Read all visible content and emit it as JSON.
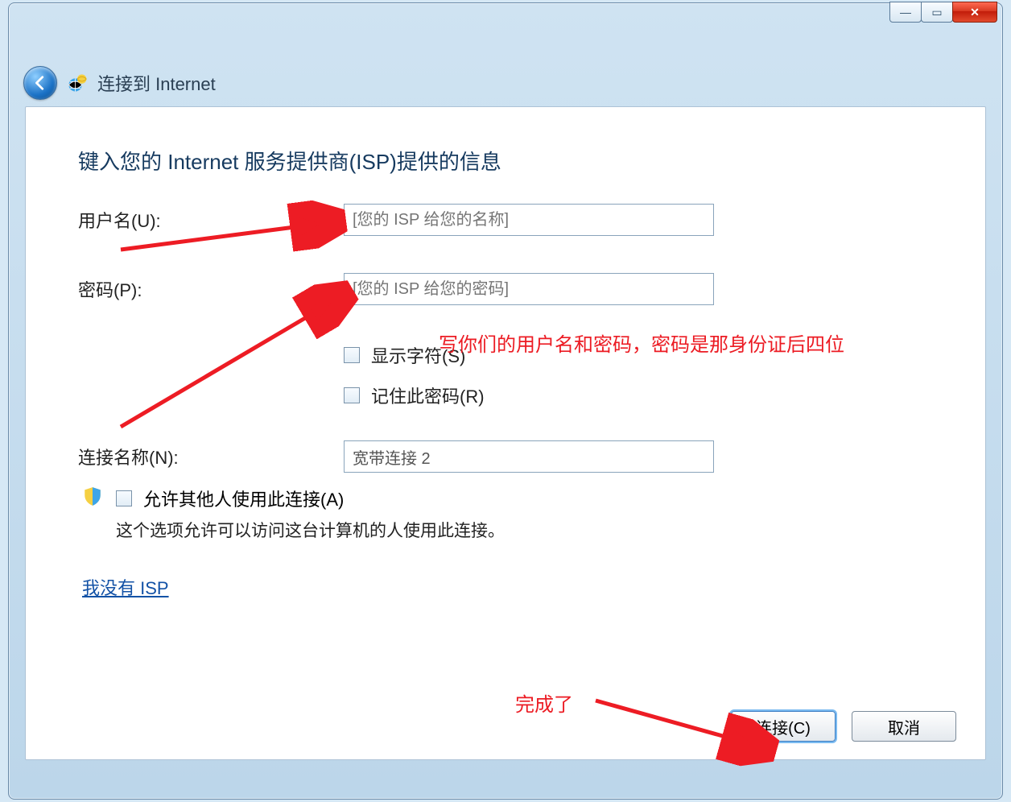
{
  "window": {
    "title": "连接到 Internet"
  },
  "heading": "键入您的 Internet 服务提供商(ISP)提供的信息",
  "form": {
    "username_label": "用户名(U):",
    "username_placeholder": "[您的 ISP 给您的名称]",
    "password_label": "密码(P):",
    "password_placeholder": "[您的 ISP 给您的密码]",
    "show_chars_label": "显示字符(S)",
    "remember_pwd_label": "记住此密码(R)",
    "conn_name_label": "连接名称(N):",
    "conn_name_value": "宽带连接 2"
  },
  "allow": {
    "label": "允许其他人使用此连接(A)",
    "sub": "这个选项允许可以访问这台计算机的人使用此连接。"
  },
  "link": "我没有 ISP",
  "buttons": {
    "connect": "连接(C)",
    "cancel": "取消"
  },
  "annotations": {
    "userpass": "写你们的用户名和密码，密码是那身份证后四位",
    "done": "完成了"
  },
  "controls": {
    "minimize": "—",
    "maximize": "▭",
    "close": "✕"
  }
}
